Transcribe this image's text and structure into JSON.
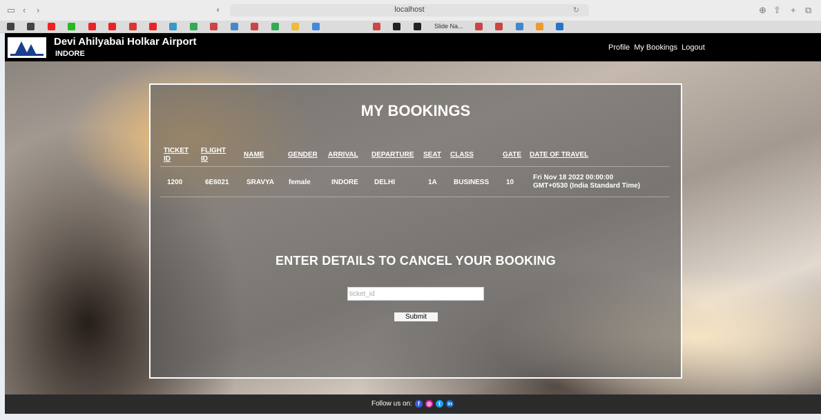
{
  "browser": {
    "url": "localhost",
    "tabs": [
      "Slide Na..."
    ]
  },
  "navbar": {
    "title": "Devi Ahilyabai Holkar Airport",
    "subtitle": "INDORE",
    "links": [
      "Profile",
      "My Bookings",
      "Logout"
    ]
  },
  "bookings": {
    "title": "MY BOOKINGS",
    "headers": {
      "ticket_id_1": "TICKET",
      "ticket_id_2": "ID",
      "flight_id_1": "FLIGHT",
      "flight_id_2": "ID",
      "name": "NAME",
      "gender": "GENDER",
      "arrival": "ARRIVAL",
      "departure": "DEPARTURE",
      "seat": "SEAT",
      "class": "CLASS",
      "gate": "GATE",
      "date": "DATE OF TRAVEL"
    },
    "rows": [
      {
        "ticket_id": "1200",
        "flight_id": "6E6021",
        "name": "SRAVYA",
        "gender": "female",
        "arrival": "INDORE",
        "departure": "DELHI",
        "seat": "1A",
        "class": "BUSINESS",
        "gate": "10",
        "date_1": "Fri Nov 18 2022 00:00:00",
        "date_2": "GMT+0530 (India Standard Time)"
      }
    ]
  },
  "cancel": {
    "title": "ENTER DETAILS TO CANCEL YOUR BOOKING",
    "placeholder": "ticket_id",
    "submit_label": "Submit"
  },
  "footer": {
    "follow_label": "Follow us on:"
  }
}
